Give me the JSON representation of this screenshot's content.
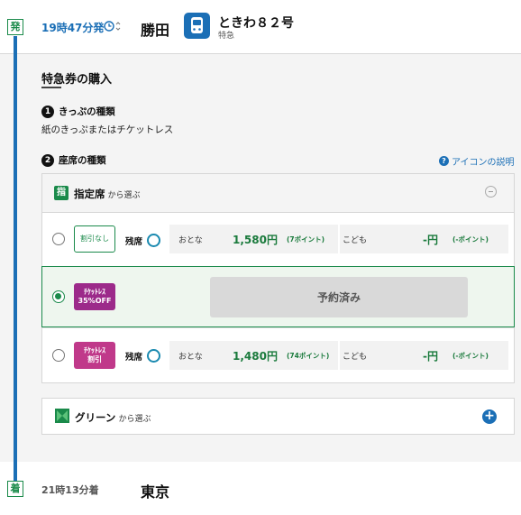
{
  "departure": {
    "badge": "発",
    "time": "19時47分発",
    "station": "勝田",
    "train_name": "ときわ８２号",
    "train_type": "特急"
  },
  "arrival": {
    "badge": "着",
    "time": "21時13分着",
    "station": "東京"
  },
  "purchase": {
    "title": "特急券の購入",
    "step1": {
      "num": "1",
      "label": "きっぷの種類",
      "value": "紙のきっぷまたはチケットレス"
    },
    "step2": {
      "num": "2",
      "label": "座席の種類"
    },
    "help_link": "アイコンの説明"
  },
  "reserved_seat": {
    "icon": "指",
    "title": "指定席",
    "suffix": "から選ぶ",
    "rows": [
      {
        "tag": "割引なし",
        "vacancy_label": "残席",
        "adult_label": "おとな",
        "adult_price": "1,580円",
        "adult_points": "(7ポイント)",
        "child_label": "こども",
        "child_price": "-円",
        "child_points": "(-ポイント)"
      },
      {
        "tag_line1": "ﾁｹｯﾄﾚｽ",
        "tag_line2": "35%OFF",
        "status": "予約済み"
      },
      {
        "tag_line1": "ﾁｹｯﾄﾚｽ",
        "tag_line2": "割引",
        "vacancy_label": "残席",
        "adult_label": "おとな",
        "adult_price": "1,480円",
        "adult_points": "(74ポイント)",
        "child_label": "こども",
        "child_price": "-円",
        "child_points": "(-ポイント)"
      }
    ]
  },
  "green_car": {
    "title": "グリーン",
    "suffix": "から選ぶ",
    "expand": "+"
  },
  "colors": {
    "accent_blue": "#1b6fb6",
    "brand_green": "#1a8a4a",
    "ticketless_purple": "#9c2a8a"
  },
  "icons": {
    "clock": "clock-icon",
    "train": "train-icon",
    "help": "help-icon",
    "vacancy": "vacancy-circle-icon",
    "green_car": "green-car-icon"
  }
}
